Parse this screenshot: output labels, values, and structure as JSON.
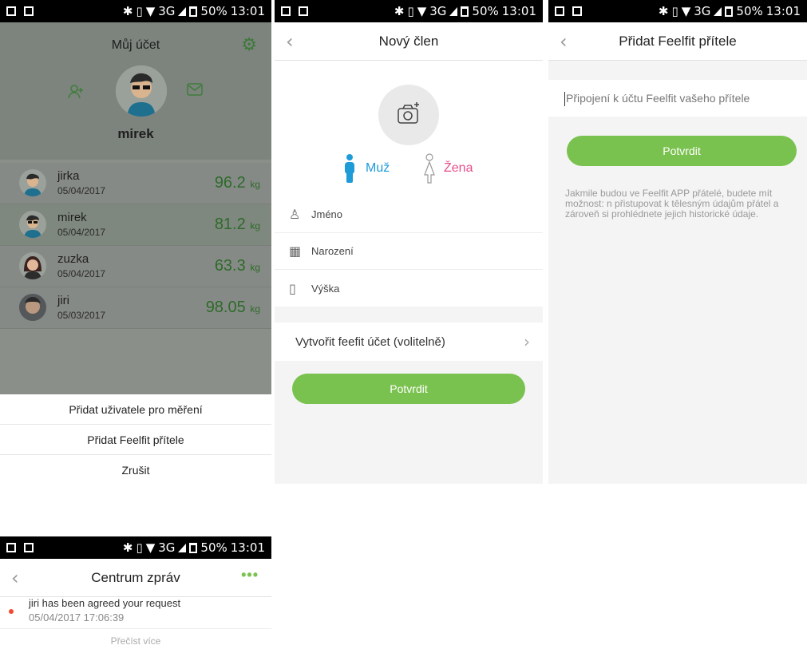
{
  "statusbar": {
    "time": "13:01",
    "battery": "50%",
    "network": "3G"
  },
  "screen1": {
    "title": "Můj účet",
    "username": "mirek",
    "users": [
      {
        "name": "jirka",
        "date": "05/04/2017",
        "weight": "96.2",
        "unit": "kg"
      },
      {
        "name": "mirek",
        "date": "05/04/2017",
        "weight": "81.2",
        "unit": "kg"
      },
      {
        "name": "zuzka",
        "date": "05/04/2017",
        "weight": "63.3",
        "unit": "kg"
      },
      {
        "name": "jiri",
        "date": "05/03/2017",
        "weight": "98.05",
        "unit": "kg"
      }
    ],
    "sheet": [
      "Přidat uživatele pro měření",
      "Přidat Feelfit přítele",
      "Zrušit"
    ]
  },
  "screen2": {
    "title": "Nový člen",
    "male": "Muž",
    "female": "Žena",
    "fields": [
      "Jméno",
      "Narození",
      "Výška"
    ],
    "account": "Vytvořit feefit účet (volitelně)",
    "confirm": "Potvrdit"
  },
  "screen3": {
    "title": "Přidat Feelfit přítele",
    "placeholder": "Připojení k účtu Feelfit vašeho přítele",
    "confirm": "Potvrdit",
    "note": "Jakmile budou ve Feelfit APP přátelé, budete mít možnost: n přistupovat k tělesným údajům přátel a zároveň si prohlédnete jejich historické údaje."
  },
  "screen4": {
    "title": "Centrum zpráv",
    "more": "•••",
    "message": {
      "text": "jiri has been agreed your request",
      "date": "05/04/2017 17:06:39"
    },
    "readmore": "Přečíst více"
  },
  "icons": {
    "back": "chevron-left-icon",
    "settings": "gear-icon",
    "add-friend": "add-person-icon",
    "mail": "mail-icon",
    "camera": "camera-icon",
    "male": "male-icon",
    "female": "female-icon"
  },
  "colors": {
    "accent_green": "#7ac24f",
    "male_blue": "#1f9bd8",
    "female_pink": "#e74d8a",
    "unread_dot": "#f04a2e"
  }
}
